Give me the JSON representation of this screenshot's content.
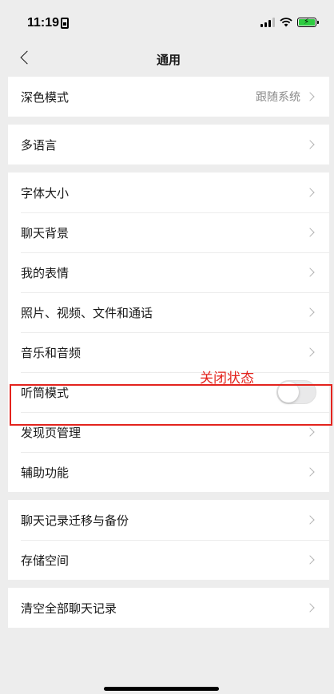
{
  "status_bar": {
    "time": "11:19"
  },
  "nav": {
    "title": "通用"
  },
  "groups": [
    {
      "rows": [
        {
          "label": "深色模式",
          "value": "跟随系统"
        }
      ]
    },
    {
      "rows": [
        {
          "label": "多语言"
        }
      ]
    },
    {
      "rows": [
        {
          "label": "字体大小"
        },
        {
          "label": "聊天背景"
        },
        {
          "label": "我的表情"
        },
        {
          "label": "照片、视频、文件和通话"
        },
        {
          "label": "音乐和音频"
        },
        {
          "label": "听筒模式",
          "toggle": false
        },
        {
          "label": "发现页管理"
        },
        {
          "label": "辅助功能"
        }
      ]
    },
    {
      "rows": [
        {
          "label": "聊天记录迁移与备份"
        },
        {
          "label": "存储空间"
        }
      ]
    },
    {
      "rows": [
        {
          "label": "清空全部聊天记录"
        }
      ]
    }
  ],
  "annotation": {
    "text": "关闭状态",
    "color": "#e3231d"
  },
  "icons": [
    "sim-card-icon",
    "signal-icon",
    "wifi-icon",
    "battery-charging-icon",
    "back-arrow-icon",
    "chevron-right-icon"
  ]
}
